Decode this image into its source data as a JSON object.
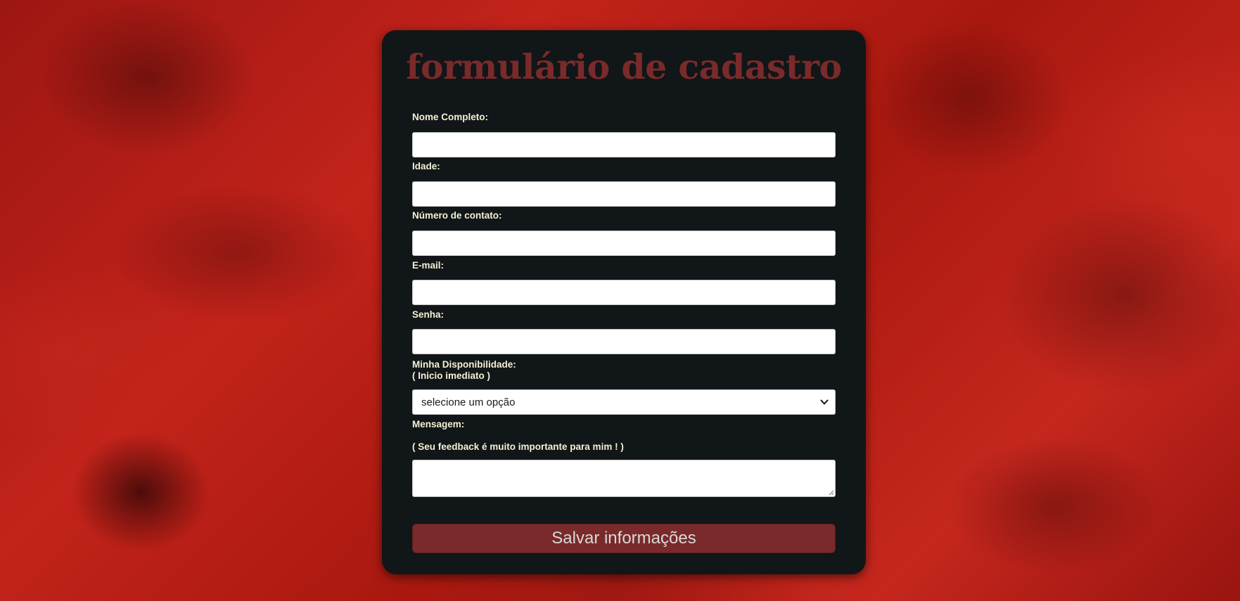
{
  "form": {
    "title": "formulário de cadastro",
    "fields": [
      {
        "label": "Nome Completo:",
        "value": "",
        "placeholder": ""
      },
      {
        "label": "Idade:",
        "value": "",
        "placeholder": ""
      },
      {
        "label": "Número de contato:",
        "value": "",
        "placeholder": ""
      },
      {
        "label": "E-mail:",
        "value": "",
        "placeholder": ""
      },
      {
        "label": "Senha:",
        "value": "",
        "placeholder": ""
      }
    ],
    "availability": {
      "label_line1": "Minha Disponibilidade:",
      "label_line2": "( Inicio imediato )",
      "selected": "selecione um opção",
      "icon": "chevron-down-icon"
    },
    "message": {
      "label": "Mensagem:",
      "hint": "( Seu feedback é muito importante para mim ! )",
      "value": ""
    },
    "save_label": "Salvar informações"
  },
  "colors": {
    "card_background": "#111618",
    "title": "#7a2a2a",
    "label": "#f4f1d4",
    "button": "#7a2a2a",
    "button_text": "#d8d8d8",
    "page_background": "#b01a14"
  }
}
